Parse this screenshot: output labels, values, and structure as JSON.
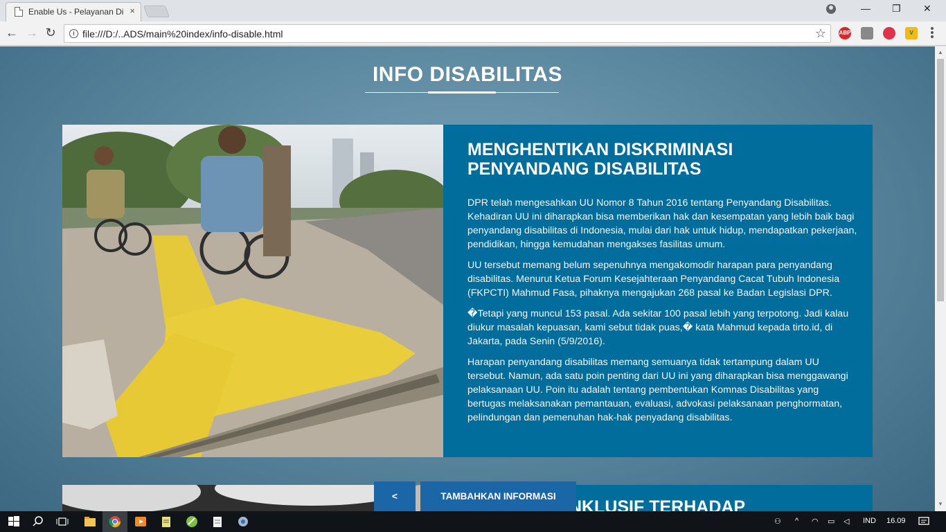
{
  "browser": {
    "tab_title": "Enable Us - Pelayanan Di",
    "tab_close": "×",
    "url": "file:///D:/..ADS/main%20index/info-disable.html",
    "window_controls": {
      "minimize": "—",
      "restore": "❐",
      "close": "✕"
    },
    "nav": {
      "back": "←",
      "forward": "→",
      "reload": "↻"
    },
    "extensions": [
      {
        "name": "adblock-plus-icon",
        "label": "ABP",
        "color": "#d9262c"
      },
      {
        "name": "camera-icon",
        "label": "",
        "color": "#777777"
      },
      {
        "name": "people-icon",
        "label": "",
        "color": "#e0334a"
      },
      {
        "name": "v-icon",
        "label": "V",
        "color": "#f2b81e"
      }
    ]
  },
  "page": {
    "section_title": "INFO DISABILITAS",
    "article": {
      "title": "MENGHENTIKAN DISKRIMINASI PENYANDANG DISABILITAS",
      "paragraphs": [
        "DPR telah mengesahkan UU Nomor 8 Tahun 2016 tentang Penyandang Disabilitas. Kehadiran UU ini diharapkan bisa memberikan hak dan kesempatan yang lebih baik bagi penyandang disabilitas di Indonesia, mulai dari hak untuk hidup, mendapatkan pekerjaan, pendidikan, hingga kemudahan mengakses fasilitas umum.",
        "UU tersebut memang belum sepenuhnya mengakomodir harapan para penyandang disabilitas. Menurut Ketua Forum Kesejahteraan Penyandang Cacat Tubuh Indonesia (FKPCTI) Mahmud Fasa, pihaknya mengajukan 268 pasal ke Badan Legislasi DPR.",
        "�Tetapi yang muncul 153 pasal. Ada sekitar 100 pasal lebih yang terpotong. Jadi kalau diukur masalah kepuasan, kami sebut tidak puas,� kata Mahmud kepada tirto.id, di Jakarta, pada Senin (5/9/2016).",
        "Harapan penyandang disabilitas memang semuanya tidak tertampung dalam UU tersebut. Namun, ada satu poin penting dari UU ini yang diharapkan bisa menggawangi pelaksanaan UU. Poin itu adalah tentang pembentukan Komnas Disabilitas yang bertugas melaksanakan pemantauan, evaluasi, advokasi pelaksanaan penghormatan, pelindungan dan pemenuhan hak-hak penyadang disabilitas."
      ]
    },
    "next_article_title": "H INKLUSIF TERHADAP",
    "prev_button": "<",
    "add_button": "TAMBAHKAN INFORMASI"
  },
  "taskbar": {
    "language": "IND",
    "time": "16.09"
  }
}
